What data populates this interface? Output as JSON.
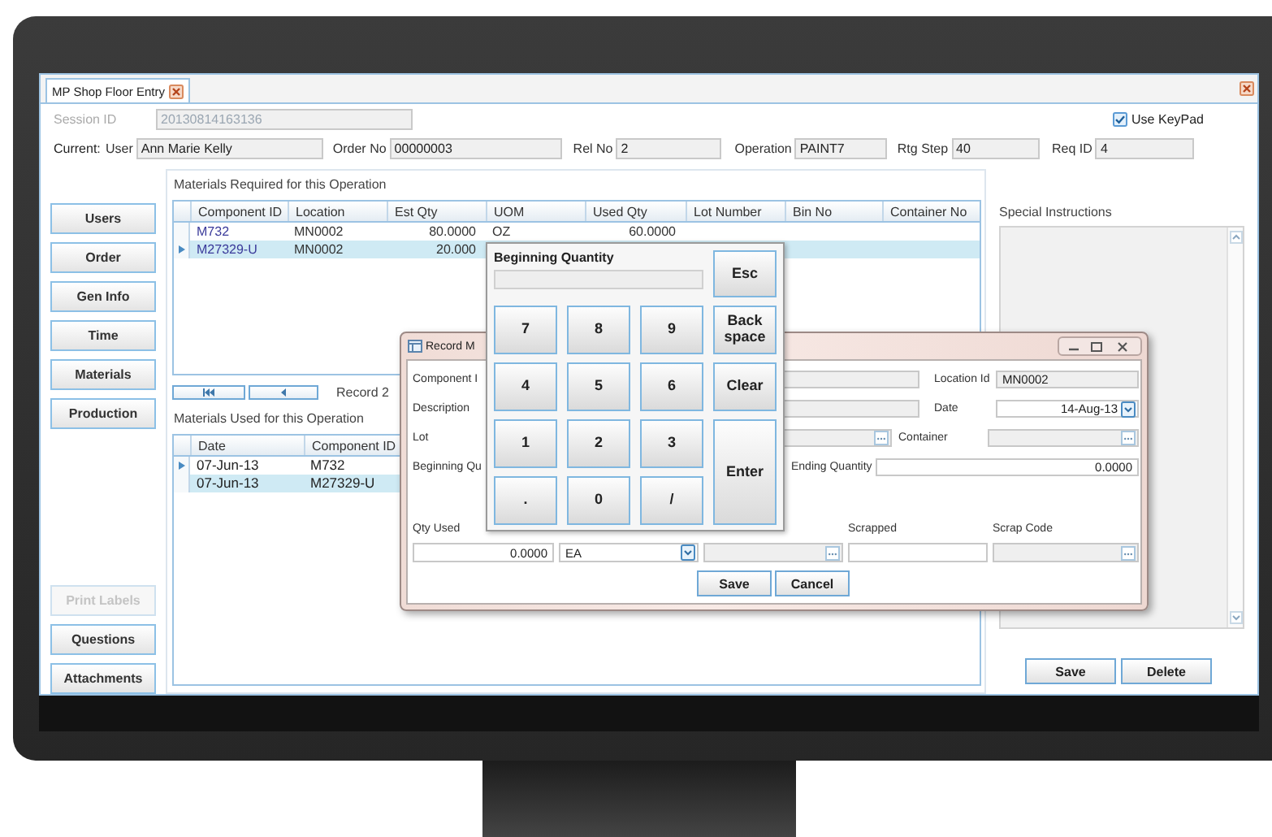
{
  "window": {
    "tab": "MP Shop Floor Entry"
  },
  "session": {
    "label": "Session ID",
    "value": "20130814163136",
    "disabled": true
  },
  "use_keypad": {
    "label": "Use KeyPad",
    "checked": true
  },
  "current": {
    "label": "Current:",
    "fields": [
      {
        "label": "User",
        "value": "Ann Marie Kelly"
      },
      {
        "label": "Order No",
        "value": "00000003"
      },
      {
        "label": "Rel No",
        "value": "2"
      },
      {
        "label": "Operation",
        "value": "PAINT7"
      },
      {
        "label": "Rtg Step",
        "value": "40"
      },
      {
        "label": "Req ID",
        "value": "4"
      }
    ]
  },
  "nav_buttons": [
    {
      "label": "Users",
      "disabled": false
    },
    {
      "label": "Order",
      "disabled": false
    },
    {
      "label": "Gen Info",
      "disabled": false
    },
    {
      "label": "Time",
      "disabled": false
    },
    {
      "label": "Materials",
      "disabled": false
    },
    {
      "label": "Production",
      "disabled": false
    }
  ],
  "bottom_buttons": [
    {
      "label": "Print Labels",
      "disabled": true
    },
    {
      "label": "Questions",
      "disabled": false
    },
    {
      "label": "Attachments",
      "disabled": false
    }
  ],
  "materials_required": {
    "title": "Materials Required for this Operation",
    "columns": [
      "Component ID",
      "Location",
      "Est Qty",
      "UOM",
      "Used Qty",
      "Lot Number",
      "Bin No",
      "Container No"
    ],
    "rows": [
      {
        "current": false,
        "selected": false,
        "cells": [
          "M732",
          "MN0002",
          "80.0000",
          "OZ",
          "60.0000"
        ]
      },
      {
        "current": true,
        "selected": true,
        "cells": [
          "M27329-U",
          "MN0002",
          "20.000"
        ]
      }
    ]
  },
  "navigator": {
    "record": "Record 2"
  },
  "materials_used": {
    "title": "Materials Used for this Operation",
    "columns": [
      "Date",
      "Component ID"
    ],
    "rows": [
      {
        "current": true,
        "selected": false,
        "cells": [
          "07-Jun-13",
          "M732"
        ]
      },
      {
        "current": false,
        "selected": true,
        "cells": [
          "07-Jun-13",
          "M27329-U"
        ]
      }
    ]
  },
  "special_instructions": {
    "label": "Special Instructions"
  },
  "actions": [
    "Save",
    "Delete"
  ],
  "record_dialog": {
    "title": "Record M",
    "rows": [
      [
        {
          "kind": "label",
          "text": "Component I"
        },
        {
          "kind": "text",
          "disabled": true
        },
        {
          "kind": "label",
          "text": "Location Id"
        },
        {
          "kind": "text",
          "value": "MN0002",
          "disabled": true
        }
      ],
      [
        {
          "kind": "label",
          "text": "Description"
        },
        {
          "kind": "text",
          "disabled": true
        },
        {
          "kind": "label",
          "text": "Date"
        },
        {
          "kind": "date",
          "value": "14-Aug-13",
          "disabled": false
        }
      ],
      [
        {
          "kind": "label",
          "text": "Lot"
        },
        {
          "kind": "lookup",
          "disabled": true
        },
        {
          "kind": "label",
          "text": "Container"
        },
        {
          "kind": "lookup",
          "disabled": true
        }
      ],
      [
        {
          "kind": "label",
          "text": "Beginning Qu"
        },
        {
          "kind": "label",
          "text": "Ending Quantity"
        },
        {
          "kind": "number",
          "value": "0.0000",
          "disabled": false
        }
      ],
      [
        {
          "kind": "label",
          "text": "Qty Used"
        },
        {
          "kind": "label",
          "text": "Scrapped"
        },
        {
          "kind": "label",
          "text": "Scrap Code"
        }
      ],
      [
        {
          "kind": "number",
          "value": "0.0000",
          "disabled": false
        },
        {
          "kind": "combo",
          "value": "EA",
          "disabled": false
        },
        {
          "kind": "lookup",
          "disabled": true
        },
        {
          "kind": "text",
          "disabled": false
        },
        {
          "kind": "lookup",
          "disabled": true
        }
      ]
    ],
    "buttons": [
      "Save",
      "Cancel"
    ]
  },
  "keypad": {
    "title": "Beginning Quantity",
    "keys": [
      "7",
      "8",
      "9",
      "4",
      "5",
      "6",
      "1",
      "2",
      "3",
      ".",
      "0",
      "/"
    ],
    "side_keys": [
      "Esc",
      "Back space",
      "Clear",
      "Enter"
    ]
  }
}
